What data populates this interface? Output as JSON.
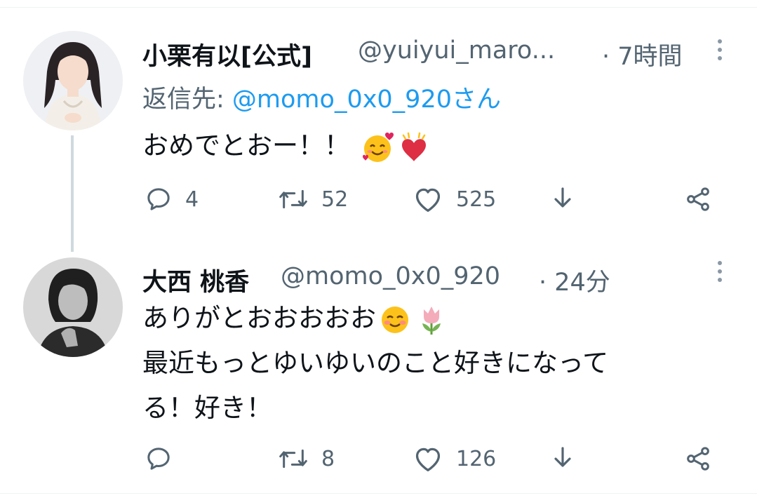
{
  "tweets": [
    {
      "name": "小栗有以[公式]",
      "handle": "@yuiyui_maro...",
      "time": "· 7時間",
      "reply_label": "返信先: ",
      "reply_mention": "@momo_0x0_920さん",
      "text_lines": [
        "おめでとおー！！"
      ],
      "emojis": [
        "smiling-face-with-hearts-emoji",
        "beating-heart-emoji"
      ],
      "actions": {
        "replies": "4",
        "retweets": "52",
        "likes": "525"
      }
    },
    {
      "name": "大西 桃香",
      "handle": "@momo_0x0_920",
      "time": "· 24分",
      "text_lines": [
        "ありがとおおおおお",
        "最近もっとゆいゆいのこと好きになって",
        "る！好き！"
      ],
      "emojis": [
        "smiling-face-blush-emoji",
        "tulip-emoji"
      ],
      "actions": {
        "replies": "",
        "retweets": "8",
        "likes": "126"
      }
    }
  ],
  "colors": {
    "text": "#0f1419",
    "secondary": "#536471",
    "link": "#1d9bf0",
    "thread_line": "#cfd9de"
  }
}
